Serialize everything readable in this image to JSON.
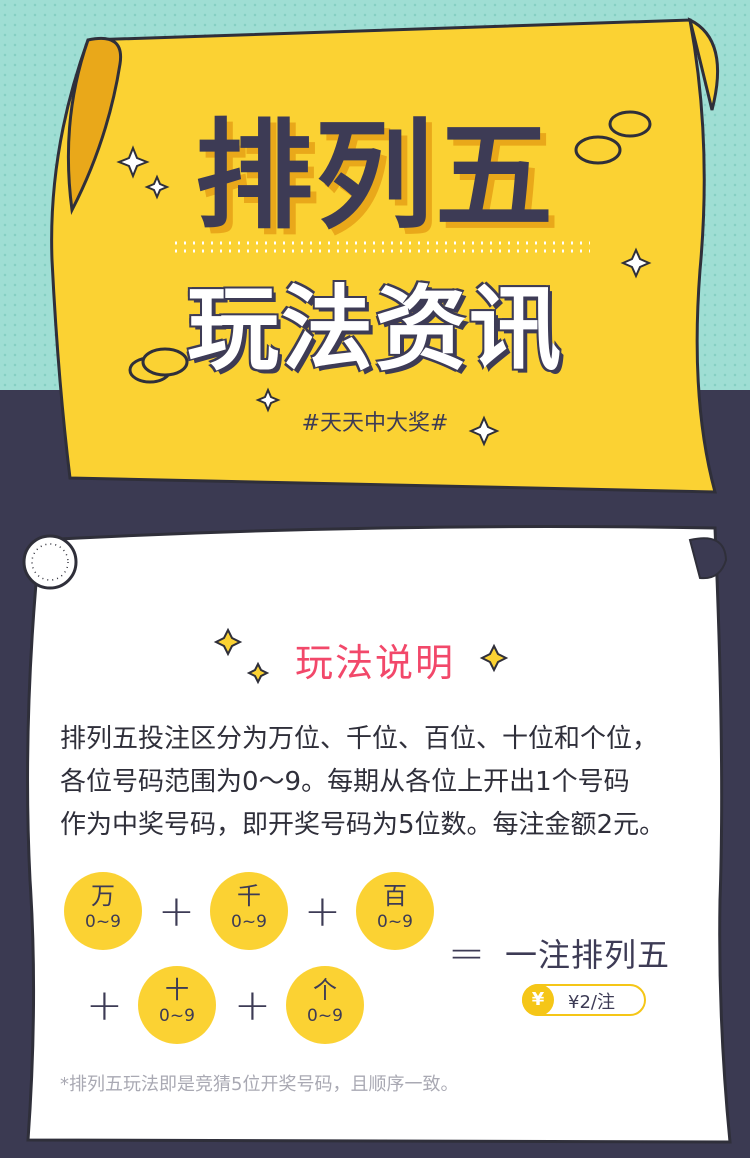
{
  "header": {
    "title": "排列五",
    "subtitle": "玩法资讯",
    "hashtag": "#天天中大奖#"
  },
  "section": {
    "title": "玩法说明",
    "description_lines": [
      "排列五投注区分为万位、千位、百位、十位和个位，",
      "各位号码范围为0～9。每期从各位上开出1个号码",
      "作为中奖号码，即开奖号码为5位数。每注金额2元。"
    ]
  },
  "formula": {
    "positions": [
      {
        "label": "万",
        "range": "0~9"
      },
      {
        "label": "千",
        "range": "0~9"
      },
      {
        "label": "百",
        "range": "0~9"
      },
      {
        "label": "十",
        "range": "0~9"
      },
      {
        "label": "个",
        "range": "0~9"
      }
    ],
    "plus": "+",
    "equals": "=",
    "result": "一注排列五",
    "price_symbol": "¥",
    "price": "¥2/注"
  },
  "footnote": "*排列五玩法即是竞猜5位开奖号码，且顺序一致。",
  "colors": {
    "teal": "#9fded4",
    "navy": "#3b3a52",
    "yellow": "#fbd233",
    "pink": "#f2486a"
  }
}
